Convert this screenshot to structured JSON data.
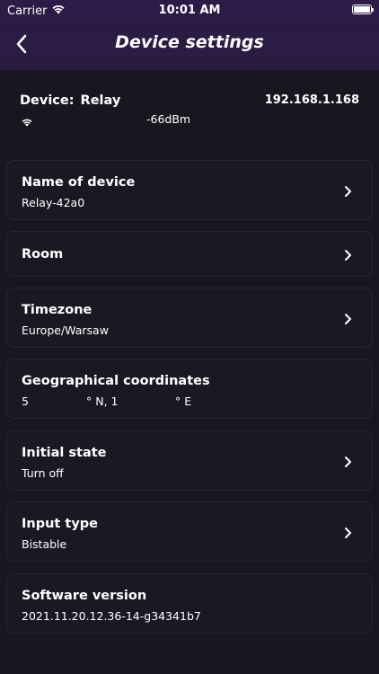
{
  "status_bar": {
    "carrier": "Carrier",
    "time": "10:01 AM",
    "wifi_icon": "wifi-icon",
    "battery_icon": "battery-icon"
  },
  "nav": {
    "back_icon": "chevron-left-icon",
    "title": "Device settings"
  },
  "device": {
    "label": "Device:",
    "name": "Relay",
    "ip": "192.168.1.168",
    "signal_icon": "wifi-icon",
    "signal": "-66dBm"
  },
  "settings": {
    "name_of_device": {
      "title": "Name of device",
      "value": "Relay-42a0"
    },
    "room": {
      "title": "Room"
    },
    "timezone": {
      "title": "Timezone",
      "value": "Europe/Warsaw"
    },
    "coordinates": {
      "title": "Geographical coordinates",
      "lat": "5",
      "lat_suffix": "° N, 1",
      "lon_suffix": "° E"
    },
    "initial_state": {
      "title": "Initial state",
      "value": "Turn off"
    },
    "input_type": {
      "title": "Input type",
      "value": "Bistable"
    },
    "software_version": {
      "title": "Software version",
      "value": "2021.11.20.12.36-14-g34341b7"
    }
  },
  "colors": {
    "background": "#1a1620",
    "header": "#2c1b47",
    "card_border": "#2a2438"
  }
}
